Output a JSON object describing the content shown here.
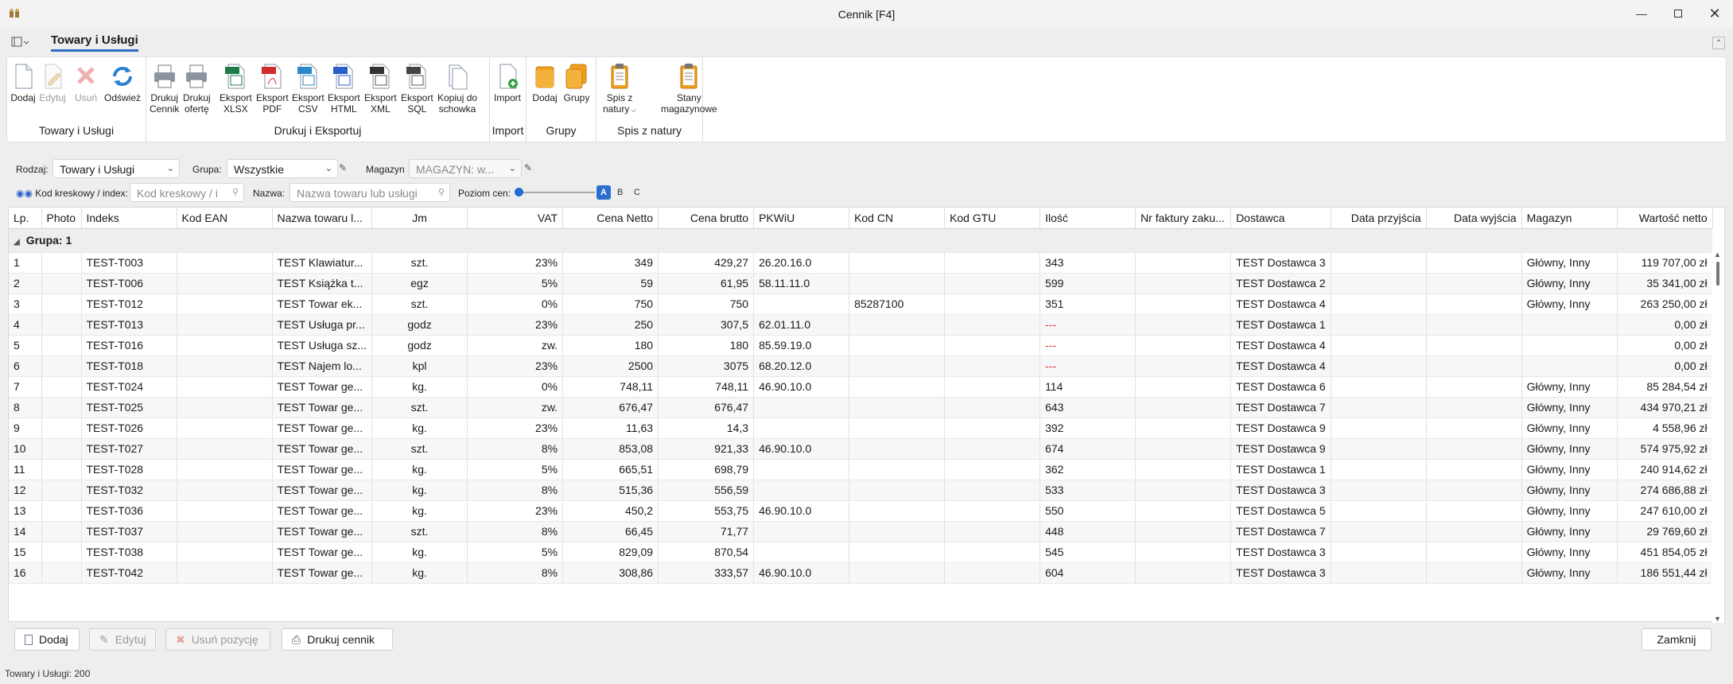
{
  "window": {
    "title": "Cennik [F4]"
  },
  "ribbon": {
    "active_tab": "Towary i Usługi",
    "groups": [
      {
        "label": "Towary i Usługi",
        "buttons": [
          {
            "label": "Dodaj",
            "icon": "new-document-icon",
            "enabled": true
          },
          {
            "label": "Edytuj",
            "icon": "edit-icon",
            "enabled": false
          },
          {
            "label": "Usuń",
            "icon": "delete-icon",
            "enabled": false
          },
          {
            "label": "Odśwież",
            "icon": "refresh-icon",
            "enabled": true
          }
        ]
      },
      {
        "label": "Drukuj i Eksportuj",
        "buttons": [
          {
            "label": "Drukuj\nCennik",
            "icon": "printer-icon",
            "enabled": true
          },
          {
            "label": "Drukuj\nofertę",
            "icon": "printer-icon",
            "enabled": true
          },
          {
            "label": "Eksport\nXLSX",
            "icon": "export-xlsx-icon",
            "enabled": true
          },
          {
            "label": "Eksport\nPDF",
            "icon": "export-pdf-icon",
            "enabled": true
          },
          {
            "label": "Eksport\nCSV",
            "icon": "export-csv-icon",
            "enabled": true
          },
          {
            "label": "Eksport\nHTML",
            "icon": "export-html-icon",
            "enabled": true
          },
          {
            "label": "Eksport\nXML",
            "icon": "export-xml-icon",
            "enabled": true
          },
          {
            "label": "Eksport\nSQL",
            "icon": "export-sql-icon",
            "enabled": true
          },
          {
            "label": "Kopiuj do\nschowka",
            "icon": "copy-icon",
            "enabled": true
          }
        ]
      },
      {
        "label": "Import",
        "buttons": [
          {
            "label": "Import",
            "icon": "import-icon",
            "enabled": true
          }
        ]
      },
      {
        "label": "Grupy",
        "buttons": [
          {
            "label": "Dodaj",
            "icon": "folder-icon",
            "enabled": true
          },
          {
            "label": "Grupy",
            "icon": "folders-icon",
            "enabled": true
          }
        ]
      },
      {
        "label": "Spis z natury",
        "buttons": [
          {
            "label": "Spis z\nnatury",
            "icon": "clipboard-icon",
            "enabled": true,
            "dropdown": true
          },
          {
            "label": "Stany\nmagazynowe",
            "icon": "clipboard-icon",
            "enabled": true
          }
        ]
      }
    ]
  },
  "filters": {
    "rodzaj_label": "Rodzaj:",
    "rodzaj_value": "Towary i Usługi",
    "grupa_label": "Grupa:",
    "grupa_value": "Wszystkie",
    "magazyn_label": "Magazyn",
    "magazyn_value": "MAGAZYN: w...",
    "kod_label": "Kod kreskowy / index:",
    "kod_placeholder": "Kod kreskowy / i",
    "nazwa_label": "Nazwa:",
    "nazwa_placeholder": "Nazwa towaru lub usługi",
    "poziom_label": "Poziom cen:",
    "levels": [
      "A",
      "B",
      "C"
    ],
    "selected_level": "A"
  },
  "grid": {
    "columns": [
      "Lp.",
      "Photo",
      "Indeks",
      "Kod EAN",
      "Nazwa towaru l...",
      "Jm",
      "VAT",
      "Cena Netto",
      "Cena brutto",
      "PKWiU",
      "Kod CN",
      "Kod GTU",
      "Ilość",
      "Nr faktury zaku...",
      "Dostawca",
      "Data przyjścia",
      "Data wyjścia",
      "Magazyn",
      "Wartość netto"
    ],
    "group_label": "Grupa: 1",
    "rows": [
      [
        "1",
        "",
        "TEST-T003",
        "",
        "TEST Klawiatur...",
        "szt.",
        "23%",
        "349",
        "429,27",
        "26.20.16.0",
        "",
        "",
        "343",
        "",
        "TEST Dostawca 3",
        "",
        "",
        "Główny, Inny",
        "119 707,00 zł"
      ],
      [
        "2",
        "",
        "TEST-T006",
        "",
        "TEST Książka t...",
        "egz",
        "5%",
        "59",
        "61,95",
        "58.11.11.0",
        "",
        "",
        "599",
        "",
        "TEST Dostawca 2",
        "",
        "",
        "Główny, Inny",
        "35 341,00 zł"
      ],
      [
        "3",
        "",
        "TEST-T012",
        "",
        "TEST Towar ek...",
        "szt.",
        "0%",
        "750",
        "750",
        "",
        "85287100",
        "",
        "351",
        "",
        "TEST Dostawca 4",
        "",
        "",
        "Główny, Inny",
        "263 250,00 zł"
      ],
      [
        "4",
        "",
        "TEST-T013",
        "",
        "TEST Usługa pr...",
        "godz",
        "23%",
        "250",
        "307,5",
        "62.01.11.0",
        "",
        "",
        "---",
        "",
        "TEST Dostawca 1",
        "",
        "",
        "",
        "0,00 zł"
      ],
      [
        "5",
        "",
        "TEST-T016",
        "",
        "TEST Usługa sz...",
        "godz",
        "zw.",
        "180",
        "180",
        "85.59.19.0",
        "",
        "",
        "---",
        "",
        "TEST Dostawca 4",
        "",
        "",
        "",
        "0,00 zł"
      ],
      [
        "6",
        "",
        "TEST-T018",
        "",
        "TEST Najem lo...",
        "kpl",
        "23%",
        "2500",
        "3075",
        "68.20.12.0",
        "",
        "",
        "---",
        "",
        "TEST Dostawca 4",
        "",
        "",
        "",
        "0,00 zł"
      ],
      [
        "7",
        "",
        "TEST-T024",
        "",
        "TEST Towar ge...",
        "kg.",
        "0%",
        "748,11",
        "748,11",
        "46.90.10.0",
        "",
        "",
        "114",
        "",
        "TEST Dostawca 6",
        "",
        "",
        "Główny, Inny",
        "85 284,54 zł"
      ],
      [
        "8",
        "",
        "TEST-T025",
        "",
        "TEST Towar ge...",
        "szt.",
        "zw.",
        "676,47",
        "676,47",
        "",
        "",
        "",
        "643",
        "",
        "TEST Dostawca 7",
        "",
        "",
        "Główny, Inny",
        "434 970,21 zł"
      ],
      [
        "9",
        "",
        "TEST-T026",
        "",
        "TEST Towar ge...",
        "kg.",
        "23%",
        "11,63",
        "14,3",
        "",
        "",
        "",
        "392",
        "",
        "TEST Dostawca 9",
        "",
        "",
        "Główny, Inny",
        "4 558,96 zł"
      ],
      [
        "10",
        "",
        "TEST-T027",
        "",
        "TEST Towar ge...",
        "szt.",
        "8%",
        "853,08",
        "921,33",
        "46.90.10.0",
        "",
        "",
        "674",
        "",
        "TEST Dostawca 9",
        "",
        "",
        "Główny, Inny",
        "574 975,92 zł"
      ],
      [
        "11",
        "",
        "TEST-T028",
        "",
        "TEST Towar ge...",
        "kg.",
        "5%",
        "665,51",
        "698,79",
        "",
        "",
        "",
        "362",
        "",
        "TEST Dostawca 1",
        "",
        "",
        "Główny, Inny",
        "240 914,62 zł"
      ],
      [
        "12",
        "",
        "TEST-T032",
        "",
        "TEST Towar ge...",
        "kg.",
        "8%",
        "515,36",
        "556,59",
        "",
        "",
        "",
        "533",
        "",
        "TEST Dostawca 3",
        "",
        "",
        "Główny, Inny",
        "274 686,88 zł"
      ],
      [
        "13",
        "",
        "TEST-T036",
        "",
        "TEST Towar ge...",
        "kg.",
        "23%",
        "450,2",
        "553,75",
        "46.90.10.0",
        "",
        "",
        "550",
        "",
        "TEST Dostawca 5",
        "",
        "",
        "Główny, Inny",
        "247 610,00 zł"
      ],
      [
        "14",
        "",
        "TEST-T037",
        "",
        "TEST Towar ge...",
        "szt.",
        "8%",
        "66,45",
        "71,77",
        "",
        "",
        "",
        "448",
        "",
        "TEST Dostawca 7",
        "",
        "",
        "Główny, Inny",
        "29 769,60 zł"
      ],
      [
        "15",
        "",
        "TEST-T038",
        "",
        "TEST Towar ge...",
        "kg.",
        "5%",
        "829,09",
        "870,54",
        "",
        "",
        "",
        "545",
        "",
        "TEST Dostawca 3",
        "",
        "",
        "Główny, Inny",
        "451 854,05 zł"
      ],
      [
        "16",
        "",
        "TEST-T042",
        "",
        "TEST Towar ge...",
        "kg.",
        "8%",
        "308,86",
        "333,57",
        "46.90.10.0",
        "",
        "",
        "604",
        "",
        "TEST Dostawca 3",
        "",
        "",
        "Główny, Inny",
        "186 551,44 zł"
      ]
    ]
  },
  "footer": {
    "add_label": "Dodaj",
    "edit_label": "Edytuj",
    "delete_label": "Usuń pozycję",
    "print_label": "Drukuj cennik",
    "close_label": "Zamknij"
  },
  "status": {
    "text": "Towary i Usługi: 200"
  }
}
